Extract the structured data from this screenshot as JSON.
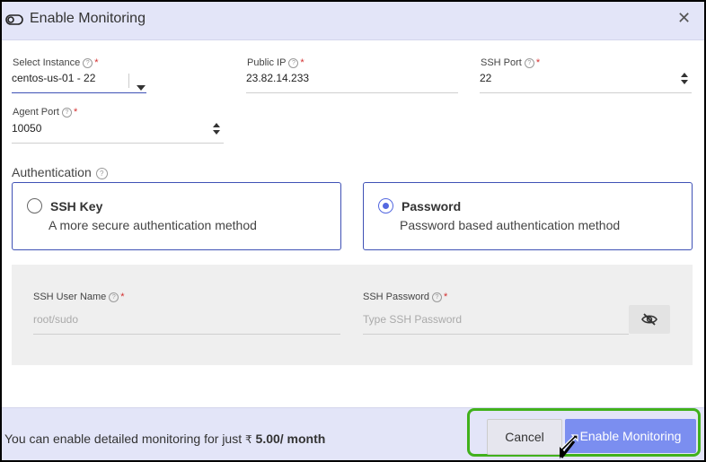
{
  "dialog": {
    "title": "Enable Monitoring",
    "close_glyph": "✕"
  },
  "fields": {
    "select_instance": {
      "label": "Select Instance",
      "value": "centos-us-01 - 22"
    },
    "public_ip": {
      "label": "Public IP",
      "value": "23.82.14.233"
    },
    "ssh_port": {
      "label": "SSH Port",
      "value": "22"
    },
    "agent_port": {
      "label": "Agent Port",
      "value": "10050"
    },
    "required_mark": "*",
    "help_glyph": "?"
  },
  "authentication": {
    "title": "Authentication",
    "selected": "password",
    "options": [
      {
        "id": "ssh_key",
        "title": "SSH Key",
        "description": "A more secure authentication method"
      },
      {
        "id": "password",
        "title": "Password",
        "description": "Password based authentication method"
      }
    ]
  },
  "credentials": {
    "ssh_user": {
      "label": "SSH User Name",
      "placeholder": "root/sudo"
    },
    "ssh_password": {
      "label": "SSH Password",
      "placeholder": "Type SSH Password"
    }
  },
  "footer": {
    "note_prefix": "You can enable detailed monitoring for just",
    "currency": "₹",
    "price": "5.00/ month",
    "cancel_label": "Cancel",
    "enable_label": "Enable Monitoring"
  },
  "colors": {
    "accent": "#5468e0",
    "primary_button": "#7b8ef0",
    "header_bg": "#e3e5f8",
    "highlight": "#41b11c",
    "required": "#d32f2f"
  },
  "icons": {
    "header": "toggle-icon",
    "close": "close-icon",
    "eye": "eye-off-icon",
    "cursor": "mouse-pointer-icon"
  }
}
